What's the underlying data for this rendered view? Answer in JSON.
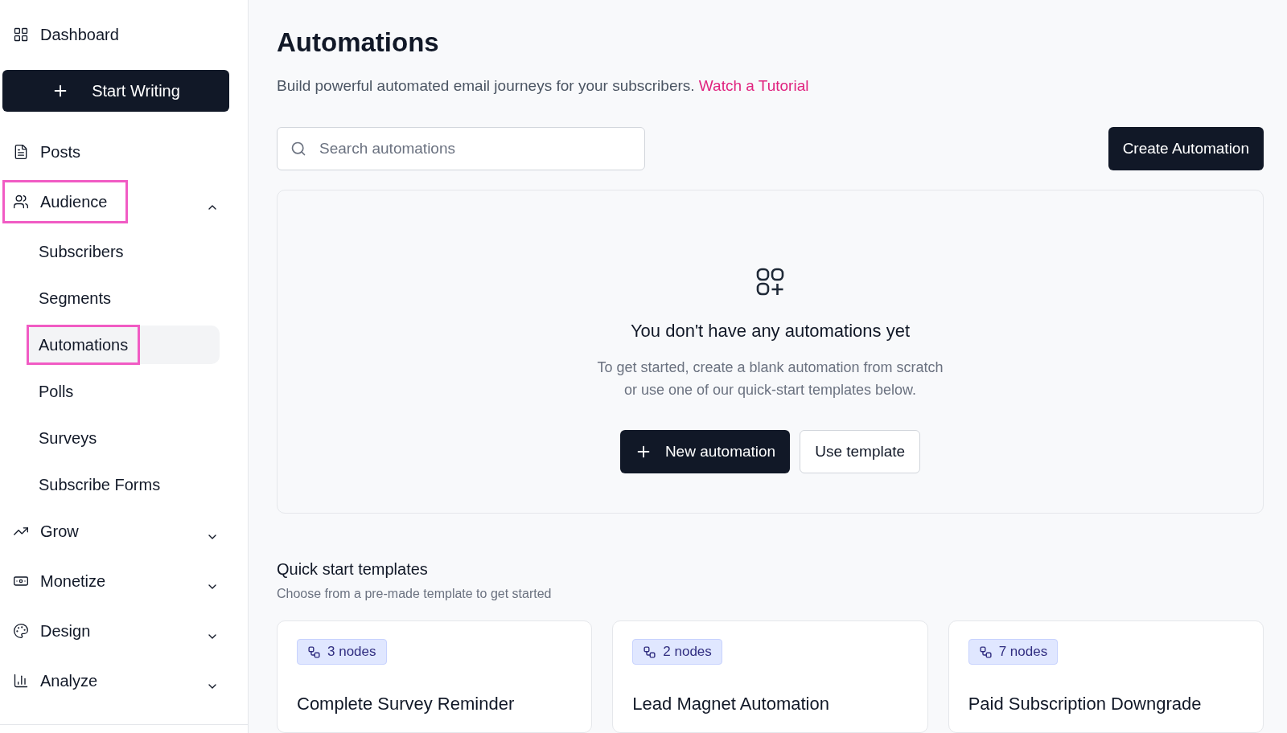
{
  "sidebar": {
    "items": [
      {
        "kind": "link",
        "label": "Dashboard"
      },
      {
        "kind": "action",
        "label": "Start Writing"
      },
      {
        "kind": "link",
        "label": "Posts"
      },
      {
        "kind": "group",
        "label": "Audience",
        "expanded": true,
        "highlighted": true,
        "children": [
          {
            "label": "Subscribers",
            "selected": false,
            "highlighted": false
          },
          {
            "label": "Segments",
            "selected": false,
            "highlighted": false
          },
          {
            "label": "Automations",
            "selected": true,
            "highlighted": true
          },
          {
            "label": "Polls",
            "selected": false,
            "highlighted": false
          },
          {
            "label": "Surveys",
            "selected": false,
            "highlighted": false
          },
          {
            "label": "Subscribe Forms",
            "selected": false,
            "highlighted": false
          }
        ]
      },
      {
        "kind": "group",
        "label": "Grow",
        "expanded": false,
        "highlighted": false
      },
      {
        "kind": "group",
        "label": "Monetize",
        "expanded": false,
        "highlighted": false
      },
      {
        "kind": "group",
        "label": "Design",
        "expanded": false,
        "highlighted": false
      },
      {
        "kind": "group",
        "label": "Analyze",
        "expanded": false,
        "highlighted": false
      }
    ]
  },
  "page": {
    "title": "Automations",
    "subtitle": "Build powerful automated email journeys for your subscribers.",
    "tutorial_link": "Watch a Tutorial",
    "search": {
      "placeholder": "Search automations"
    },
    "create_button": "Create Automation"
  },
  "empty_state": {
    "heading": "You don't have any automations yet",
    "description": [
      "To get started, create a blank automation from scratch",
      "or use one of our quick-start templates below."
    ],
    "primary_button": "New automation",
    "secondary_button": "Use template"
  },
  "templates": {
    "title": "Quick start templates",
    "subtitle": "Choose from a pre-made template to get started",
    "cards": [
      {
        "nodes": "3 nodes",
        "title": "Complete Survey Reminder"
      },
      {
        "nodes": "2 nodes",
        "title": "Lead Magnet Automation"
      },
      {
        "nodes": "7 nodes",
        "title": "Paid Subscription Downgrade"
      }
    ]
  }
}
